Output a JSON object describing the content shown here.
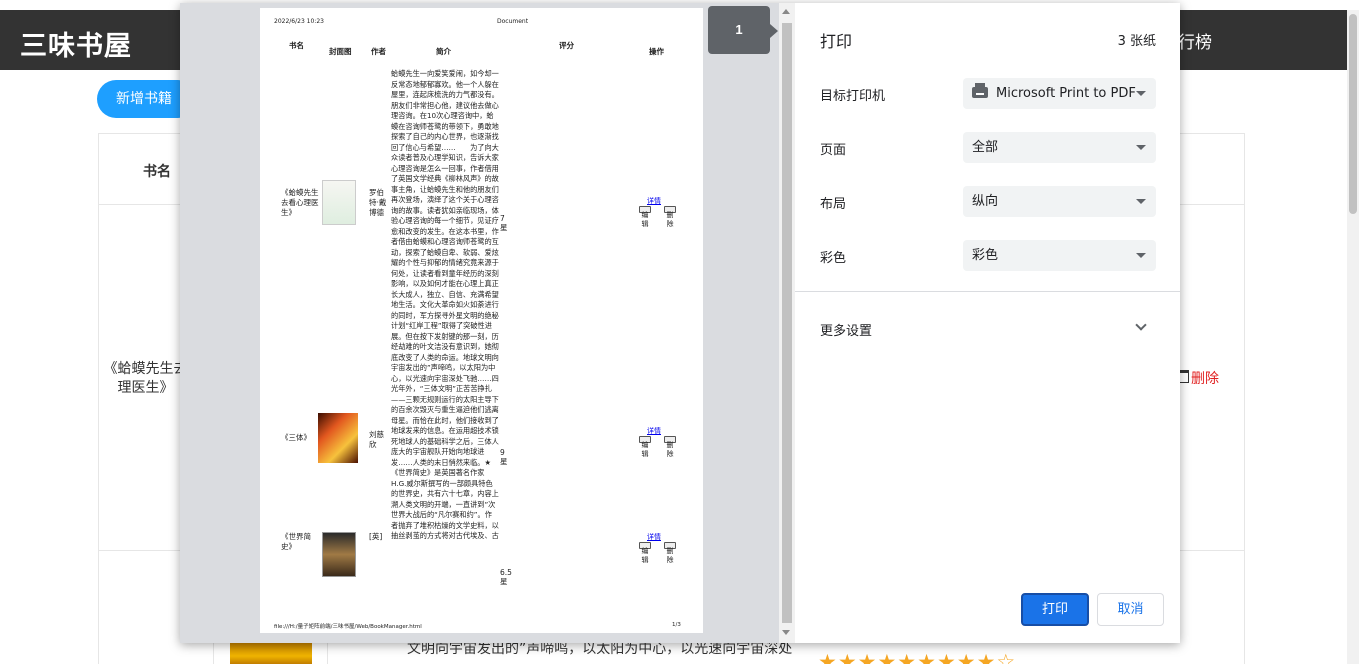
{
  "background": {
    "site_title": "三味书屋",
    "nav_rank_partial": "行榜",
    "add_button": "新增书籍",
    "table_header_name": "书名",
    "row1_title": "《蛤蟆先生去看心理医生》",
    "row1_title_visible": "《蛤蟆先生去\n理医生》",
    "delete_label": "删除",
    "bottom_intro": "文明向宇宙发出的”声啼鸣，以太阳为中心，以光速向宇宙深处",
    "bottom_stars": "★★★★★★★★★☆"
  },
  "dialog": {
    "title": "打印",
    "sheet_count": "3 张纸",
    "page_badge": "1",
    "printer_label": "目标打印机",
    "printer_value": "Microsoft Print to PDF",
    "pages_label": "页面",
    "pages_value": "全部",
    "layout_label": "布局",
    "layout_value": "纵向",
    "color_label": "彩色",
    "color_value": "彩色",
    "more_settings": "更多设置",
    "print_button": "打印",
    "cancel_button": "取消"
  },
  "preview": {
    "date": "2022/6/23 10:23",
    "doc_title": "Document",
    "headers": {
      "name": "书名",
      "cover": "封面图",
      "author": "作者",
      "intro": "简介",
      "score": "评分",
      "ops": "操作"
    },
    "intro_text": "蛤蟆先生一向爱笑爱闹，如今却一反常态地郁郁寡欢。他一个人躲在屋里，连起床梳洗的力气都没有。朋友们非常担心他，建议他去做心理咨询。在10次心理咨询中，蛤蟆在咨询师苍鹭的带领下，勇敢地探索了自己的内心世界，也逐渐找回了信心与希望……　　为了向大众读者普及心理学知识，告诉大家心理咨询是怎么一回事，作者借用了英国文学经典《柳林风声》的故事主角，让蛤蟆先生和他的朋友们再次登场，演绎了这个关于心理咨询的故事。读者犹如亲临现场，体验心理咨询的每一个细节，见证疗愈和改变的发生。在这本书里，作者借由蛤蟆和心理咨询师苍鹭的互动，探索了蛤蟆自卑、软弱、爱炫耀的个性与抑郁的情绪究竟来源于何处，让读者看到童年经历的深刻影响，以及如何才能在心理上真正长大成人，独立、自信、充满希望地生活。文化大革命如火如荼进行的同时，军方探寻外星文明的绝秘计划“红岸工程”取得了突破性进展。但在按下发射键的那一刻，历经劫难的叶文洁没有意识到，她彻底改变了人类的命运。地球文明向宇宙发出的”声啼鸣，以太阳为中心，以光速向宇宙深处飞驰……四光年外，“三体文明”正苦苦挣扎——三颗无规则运行的太阳主导下的百余次毁灭与重生逼迫他们逃离母星。而恰在此时，他们接收到了地球发来的信息。在运用超技术锁死地球人的基础科学之后，三体人庞大的宇宙舰队开始向地球进发……人类的末日悄然来临。★《世界简史》是英国著名作家H.G.威尔斯撰写的一部颇具特色的世界史，共有六十七章，内容上溯人类文明的开端，一直讲到”次世界大战后的“凡尔赛和约”。作者抛弃了堆积枯燥的文学史料，以抽丝剥茧的方式将对古代埃及、古",
    "books": [
      {
        "title": "《蛤蟆先生去看心理医生》",
        "author": "罗伯特·戴博德",
        "score": "7星",
        "link": "详情",
        "edit": "编辑",
        "del": "删除"
      },
      {
        "title": "《三体》",
        "author": "刘慈欣",
        "score": "9星",
        "link": "详情",
        "edit": "编辑",
        "del": "删除"
      },
      {
        "title": "《世界简史》",
        "author": "[英]",
        "score": "6.5星",
        "link": "详情",
        "edit": "编辑",
        "del": "删除"
      }
    ],
    "footer_path": "file:///H:/量子矩阵前端/三味书屋/Web/BookManager.html",
    "footer_page": "1/3"
  },
  "colors": {
    "primary": "#1a73e8",
    "header_bg": "#333333",
    "add_button": "#1e9fff",
    "delete_red": "#e02020"
  }
}
